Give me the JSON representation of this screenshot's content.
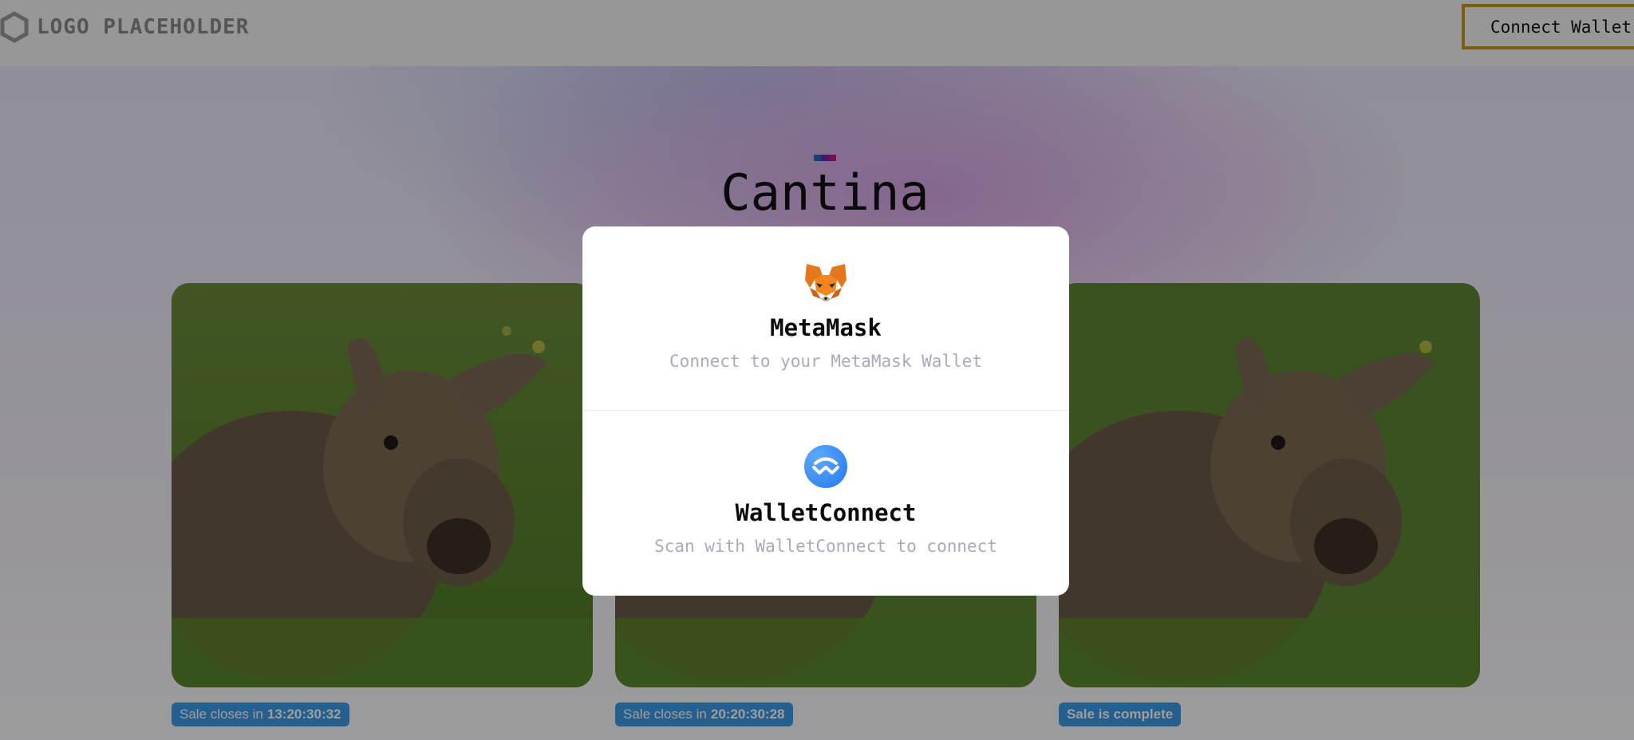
{
  "header": {
    "logo_text": "LOGO PLACEHOLDER",
    "connect_wallet_label": "Connect Wallet"
  },
  "hero": {
    "title": "Cantina",
    "brand_colors": [
      "#1f6fb6",
      "#6a2aa8",
      "#c2188c"
    ]
  },
  "cards": [
    {
      "image": "bighorn-lamb-photo",
      "badge_prefix": "Sale closes in",
      "badge_value": "13:20:30:32"
    },
    {
      "image": "bighorn-lamb-photo",
      "badge_prefix": "Sale closes in",
      "badge_value": "20:20:30:28"
    },
    {
      "image": "bighorn-lamb-photo",
      "badge_prefix": "",
      "badge_value": "Sale is complete"
    }
  ],
  "modal": {
    "options": [
      {
        "name": "MetaMask",
        "description": "Connect to your MetaMask Wallet",
        "icon": "metamask-fox-icon"
      },
      {
        "name": "WalletConnect",
        "description": "Scan with WalletConnect to connect",
        "icon": "walletconnect-icon"
      }
    ]
  },
  "colors": {
    "accent_border": "#c79a1a",
    "badge_bg": "#3a9ae6",
    "walletconnect_blue": "#3b99fc"
  }
}
